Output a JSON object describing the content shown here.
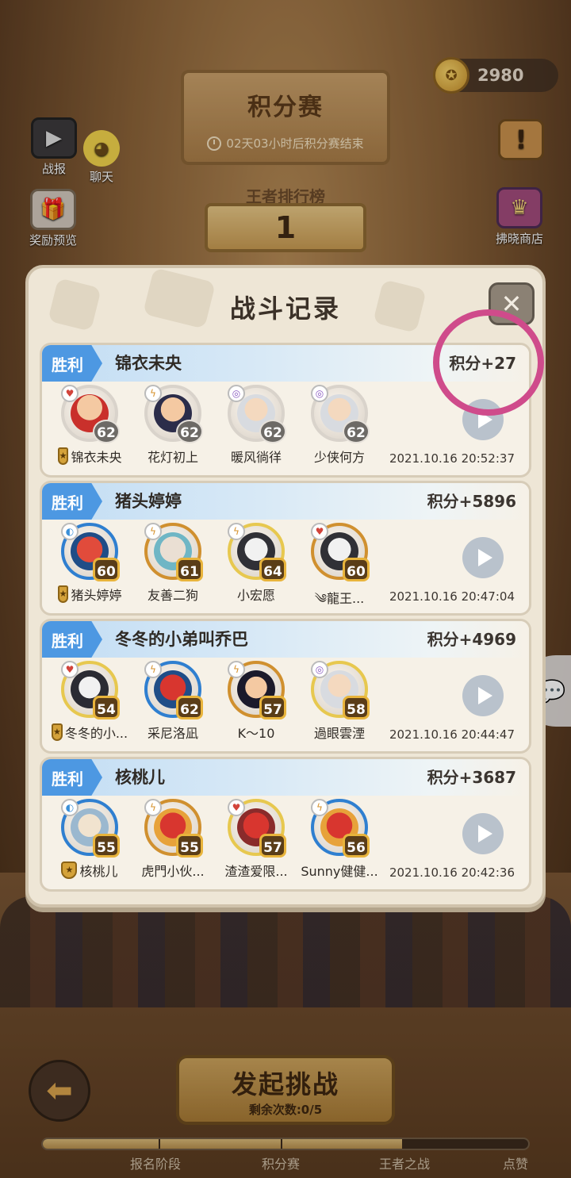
{
  "header": {
    "title": "积分赛",
    "countdown": "02天03小时后积分赛结束",
    "rank_label": "王者排行榜",
    "rank_value": "1",
    "currency": "2980"
  },
  "side_buttons": {
    "battle_report": "战报",
    "chat": "聊天",
    "reward_preview": "奖励预览",
    "shop": "拂晓商店"
  },
  "dialog": {
    "title": "战斗记录",
    "records": [
      {
        "result": "胜利",
        "opponent": "锦衣未央",
        "score": "积分+27",
        "time": "2021.10.16 20:52:37",
        "members": [
          {
            "name": "锦衣未央",
            "level": "62"
          },
          {
            "name": "花灯初上",
            "level": "62"
          },
          {
            "name": "暖风徜徉",
            "level": "62"
          },
          {
            "name": "少侠何方",
            "level": "62"
          }
        ]
      },
      {
        "result": "胜利",
        "opponent": "猪头婷婷",
        "score": "积分+5896",
        "time": "2021.10.16 20:47:04",
        "members": [
          {
            "name": "猪头婷婷",
            "level": "60"
          },
          {
            "name": "友善二狗",
            "level": "61"
          },
          {
            "name": "小宏愿",
            "level": "64"
          },
          {
            "name": "༄龍王...",
            "level": "60"
          }
        ]
      },
      {
        "result": "胜利",
        "opponent": "冬冬的小弟叫乔巴",
        "score": "积分+4969",
        "time": "2021.10.16 20:44:47",
        "members": [
          {
            "name": "冬冬的小...",
            "level": "54"
          },
          {
            "name": "采尼洛凪",
            "level": "62"
          },
          {
            "name": "K～10",
            "level": "57"
          },
          {
            "name": "過眼雲湮",
            "level": "58"
          }
        ]
      },
      {
        "result": "胜利",
        "opponent": "核桃儿",
        "score": "积分+3687",
        "time": "2021.10.16 20:42:36",
        "members": [
          {
            "name": "核桃儿",
            "level": "55"
          },
          {
            "name": "虎門小伙...",
            "level": "55"
          },
          {
            "name": "渣渣爱限...",
            "level": "57"
          },
          {
            "name": "Sunny健健...",
            "level": "56"
          }
        ]
      }
    ]
  },
  "bottom": {
    "challenge_label": "发起挑战",
    "remaining": "剩余次数:0/5",
    "stages": [
      "报名阶段",
      "积分赛",
      "王者之战",
      "点赞"
    ],
    "progress": 0.74
  },
  "colors": {
    "win_badge": "#4d98e2",
    "highlight": "#cf4b8b",
    "dialog_bg": "#eee6d6"
  }
}
